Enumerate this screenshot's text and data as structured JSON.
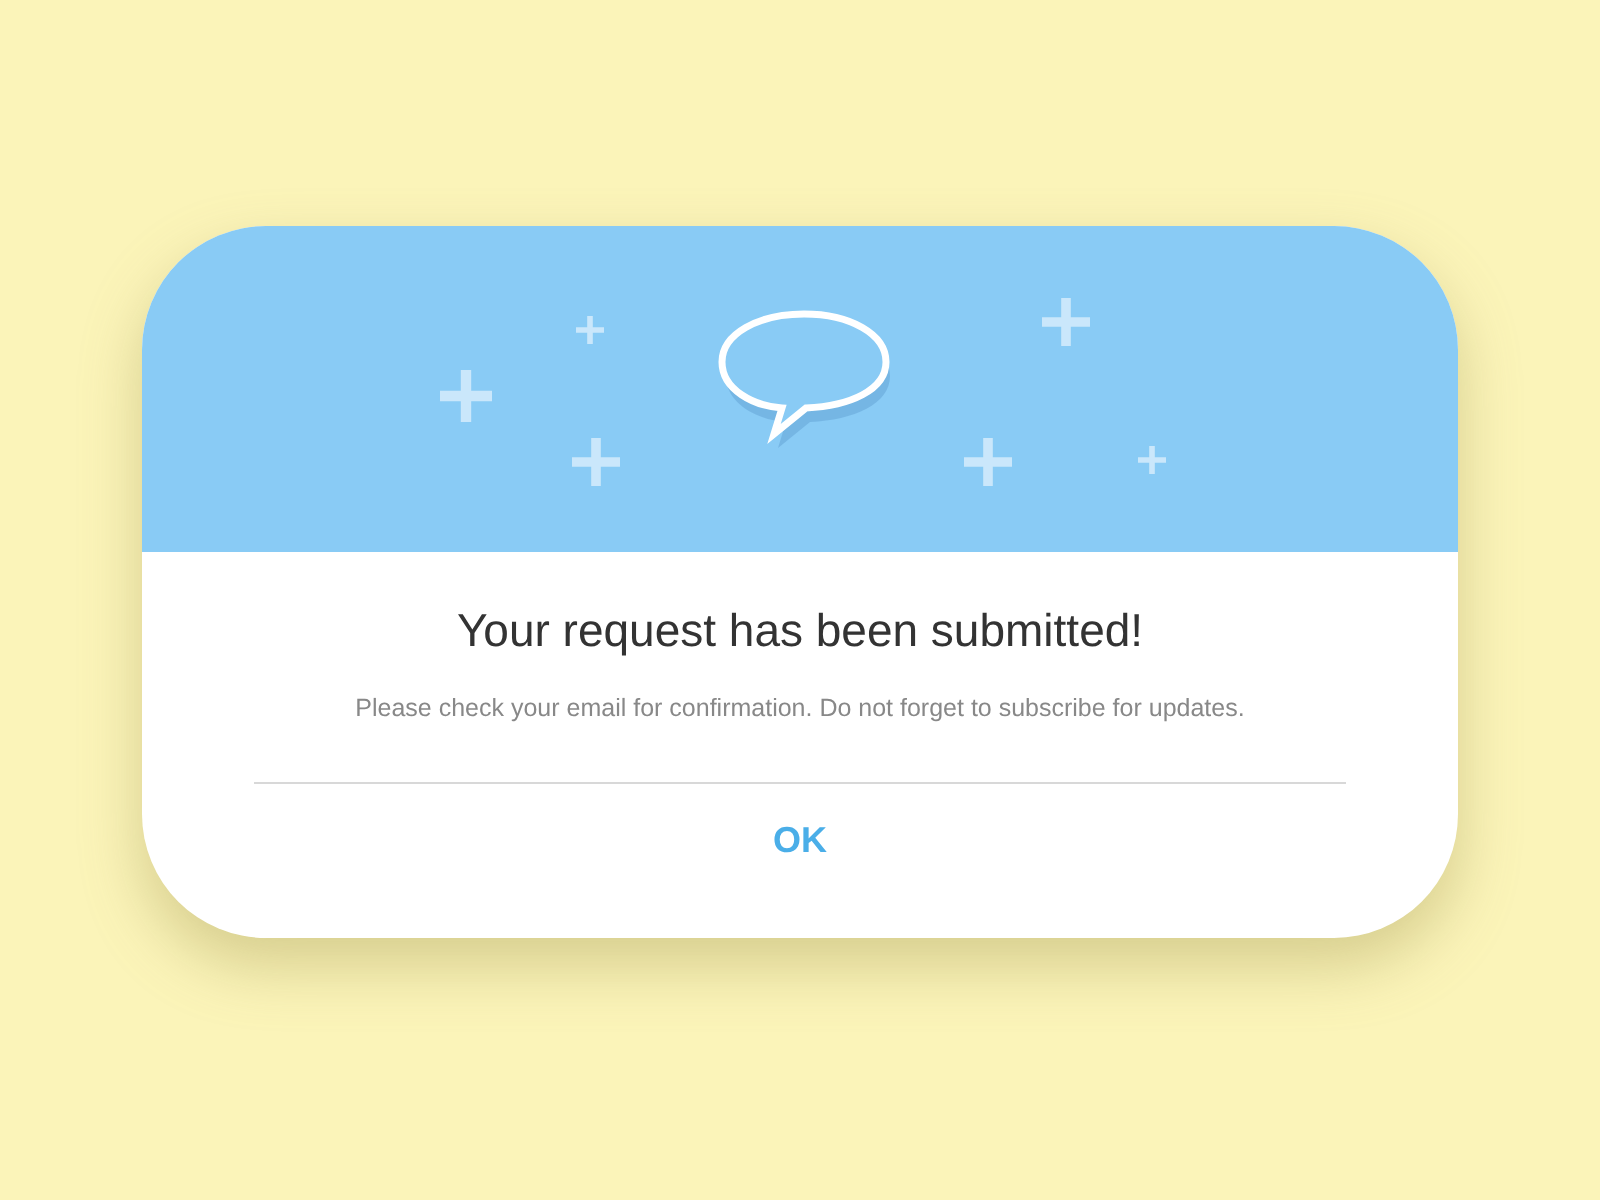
{
  "dialog": {
    "title": "Your request has been submitted!",
    "message": "Please check your email for confirmation. Do not forget to subscribe for updates.",
    "button": "OK"
  }
}
